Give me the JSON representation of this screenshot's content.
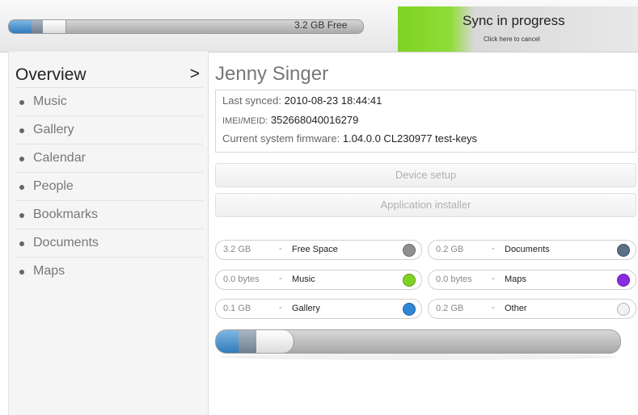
{
  "topbar": {
    "free_label": "3.2 GB Free",
    "sync_title": "Sync in progress",
    "sync_subtitle": "Click here to cancel",
    "sync_color": "#7ed321"
  },
  "sidebar": {
    "title": "Overview",
    "chevron": ">",
    "items": [
      {
        "label": "Music",
        "icon": "bullet-icon"
      },
      {
        "label": "Gallery",
        "icon": "bullet-icon"
      },
      {
        "label": "Calendar",
        "icon": "bullet-icon"
      },
      {
        "label": "People",
        "icon": "bullet-icon"
      },
      {
        "label": "Bookmarks",
        "icon": "bullet-icon"
      },
      {
        "label": "Documents",
        "icon": "bullet-icon"
      },
      {
        "label": "Maps",
        "icon": "bullet-icon"
      }
    ]
  },
  "device": {
    "name": "Jenny Singer",
    "last_synced_label": "Last synced:",
    "last_synced_value": "2010-08-23 18:44:41",
    "imei_label": "IMEI/MEID:",
    "imei_value": "352668040016279",
    "firmware_label": "Current system firmware:",
    "firmware_value": "1.04.0.0 CL230977 test-keys"
  },
  "actions": {
    "device_setup": "Device setup",
    "application_installer": "Application installer"
  },
  "storage": {
    "dash": "-",
    "items": [
      {
        "size": "3.2 GB",
        "name": "Free Space",
        "color": "#8f8f8f"
      },
      {
        "size": "0.2 GB",
        "name": "Documents",
        "color": "#5b6f86"
      },
      {
        "size": "0.0 bytes",
        "name": "Music",
        "color": "#7ed321"
      },
      {
        "size": "0.0 bytes",
        "name": "Maps",
        "color": "#8a2be2"
      },
      {
        "size": "0.1 GB",
        "name": "Gallery",
        "color": "#2f86d6"
      },
      {
        "size": "0.2 GB",
        "name": "Other",
        "color": "#f2f2f2"
      }
    ]
  }
}
